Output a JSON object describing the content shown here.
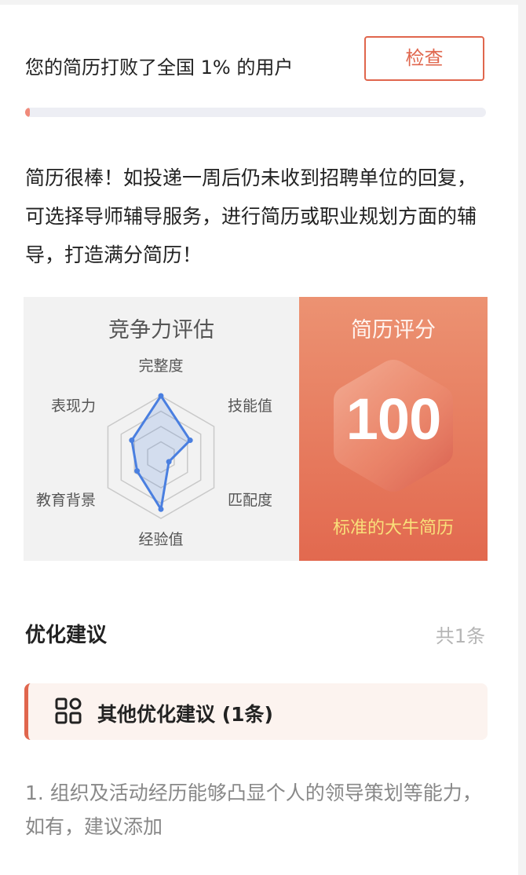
{
  "header": {
    "rank_text": "您的简历打败了全国 1% 的用户",
    "check_label": "检查",
    "progress": 0.01
  },
  "summary": "简历很棒！如投递一周后仍未收到招聘单位的回复，可选择导师辅导服务，进行简历或职业规划方面的辅导，打造满分简历！",
  "assessment": {
    "title": "竞争力评估",
    "axes": [
      "完整度",
      "技能值",
      "匹配度",
      "经验值",
      "教育背景",
      "表现力"
    ],
    "values": [
      1.0,
      0.55,
      0.15,
      0.85,
      0.45,
      0.55
    ],
    "color": "#4a7fe0"
  },
  "score": {
    "title": "简历评分",
    "value": "100",
    "subtitle": "标准的大牛简历"
  },
  "optimization": {
    "title": "优化建议",
    "count": "共1条",
    "group_label": "其他优化建议 (1条)",
    "icon": "grid-icon",
    "items": [
      "1.  组织及活动经历能够凸显个人的领导策划等能力，如有，建议添加"
    ]
  },
  "colors": {
    "accent": "#e0664d",
    "score_bg_top": "#ec9272",
    "score_bg_bottom": "#e2694f",
    "subtitle": "#f9e07a"
  }
}
